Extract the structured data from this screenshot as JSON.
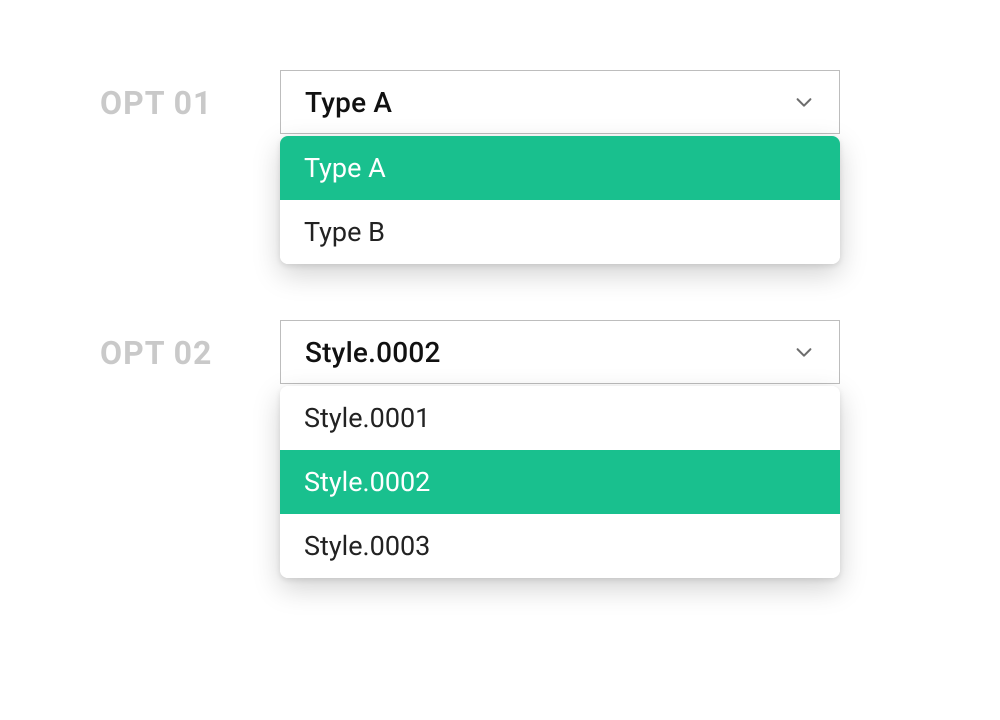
{
  "colors": {
    "accent": "#19c08e",
    "labelMuted": "#c9c9c9",
    "border": "#bdbdbd",
    "text": "#111"
  },
  "groups": [
    {
      "label": "OPT 01",
      "selected": "Type A",
      "selectedIndex": 0,
      "options": [
        "Type A",
        "Type B"
      ]
    },
    {
      "label": "OPT 02",
      "selected": "Style.0002",
      "selectedIndex": 1,
      "options": [
        "Style.0001",
        "Style.0002",
        "Style.0003"
      ]
    }
  ]
}
